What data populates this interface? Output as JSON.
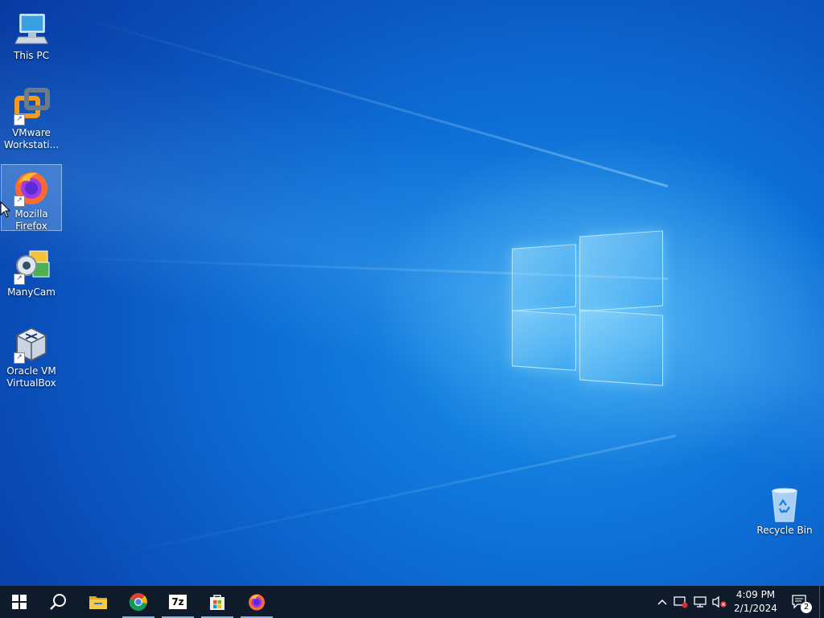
{
  "desktop": {
    "icons": [
      {
        "label": "This PC",
        "icon": "this-pc-icon"
      },
      {
        "label": "VMware Workstati...",
        "icon": "vmware-icon",
        "shortcut": true
      },
      {
        "label": "Mozilla Firefox",
        "icon": "firefox-icon",
        "shortcut": true,
        "selected": true
      },
      {
        "label": "ManyCam",
        "icon": "manycam-icon",
        "shortcut": true
      },
      {
        "label": "Oracle VM VirtualBox",
        "icon": "virtualbox-icon",
        "shortcut": true
      },
      {
        "label": "Recycle Bin",
        "icon": "recycle-bin-icon"
      }
    ]
  },
  "taskbar": {
    "start": "windows-start-icon",
    "search": "search-icon",
    "pinned": [
      {
        "name": "file-explorer-icon"
      },
      {
        "name": "chrome-icon"
      },
      {
        "name": "7zip-icon",
        "text": "7z"
      },
      {
        "name": "microsoft-store-icon"
      },
      {
        "name": "firefox-icon"
      }
    ],
    "tray": {
      "time": "4:09 PM",
      "date": "2/1/2024",
      "notifications_count": "2"
    }
  },
  "colors": {
    "taskbar": "#0f1a2a",
    "desktop_blue": "#0d6fd6",
    "accent": "#1a8fe8"
  }
}
